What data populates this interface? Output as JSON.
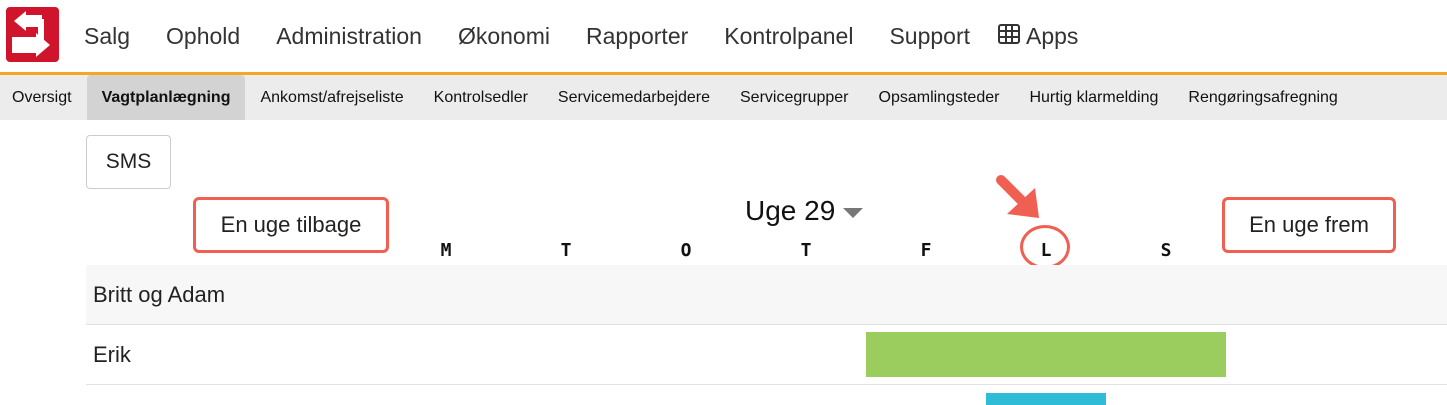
{
  "brand": {
    "logo_color": "#d0142c",
    "accent_color": "#f5a623",
    "highlight_color": "#f06052"
  },
  "main_nav": [
    "Salg",
    "Ophold",
    "Administration",
    "Økonomi",
    "Rapporter",
    "Kontrolpanel",
    "Support"
  ],
  "apps": {
    "icon": "grid-icon",
    "label": "Apps"
  },
  "sub_nav": [
    "Oversigt",
    "Vagtplanlægning",
    "Ankomst/afrejseliste",
    "Kontrolsedler",
    "Servicemedarbejdere",
    "Servicegrupper",
    "Opsamlingsteder",
    "Hurtig klarmelding",
    "Rengøringsafregning"
  ],
  "sub_nav_active": "Vagtplanlægning",
  "toolbar": {
    "sms_label": "SMS"
  },
  "schedule": {
    "prev_week_label": "En uge tilbage",
    "next_week_label": "En uge frem",
    "week_title": "Uge 29",
    "days": [
      "M",
      "T",
      "O",
      "T",
      "F",
      "L",
      "S"
    ],
    "highlighted_day": "L",
    "rows": [
      {
        "name": "Britt og Adam",
        "bars": []
      },
      {
        "name": "Erik",
        "bars": [
          {
            "color": "#9acd5e",
            "from_day": "F",
            "to_day": "S"
          }
        ]
      },
      {
        "name": "",
        "bars": [
          {
            "color": "#2fbcd6",
            "from_day": "L",
            "to_day": "L"
          }
        ]
      }
    ]
  }
}
